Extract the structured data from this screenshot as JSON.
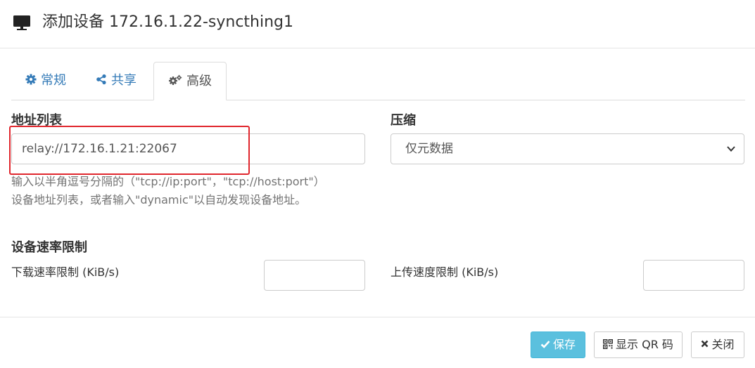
{
  "header": {
    "title": "添加设备 172.16.1.22-syncthing1",
    "icon": "monitor-icon"
  },
  "tabs": [
    {
      "label": "常规",
      "icon": "gear-icon",
      "active": false
    },
    {
      "label": "共享",
      "icon": "share-icon",
      "active": false
    },
    {
      "label": "高级",
      "icon": "gears-icon",
      "active": true
    }
  ],
  "address": {
    "label": "地址列表",
    "value": "relay://172.16.1.21:22067",
    "help_line1": "输入以半角逗号分隔的（\"tcp://ip:port\"，\"tcp://host:port\"）",
    "help_line2": "设备地址列表，或者输入\"dynamic\"以自动发现设备地址。"
  },
  "compression": {
    "label": "压缩",
    "selected": "仅元数据"
  },
  "rate_limit": {
    "label": "设备速率限制",
    "download_label": "下载速率限制 (KiB/s)",
    "download_value": "",
    "upload_label": "上传速度限制 (KiB/s)",
    "upload_value": ""
  },
  "footer": {
    "save_label": "保存",
    "qr_label": "显示 QR 码",
    "close_label": "关闭"
  },
  "colors": {
    "link": "#337ab7",
    "save_button": "#5bc0de",
    "highlight_box": "#e0262d"
  }
}
